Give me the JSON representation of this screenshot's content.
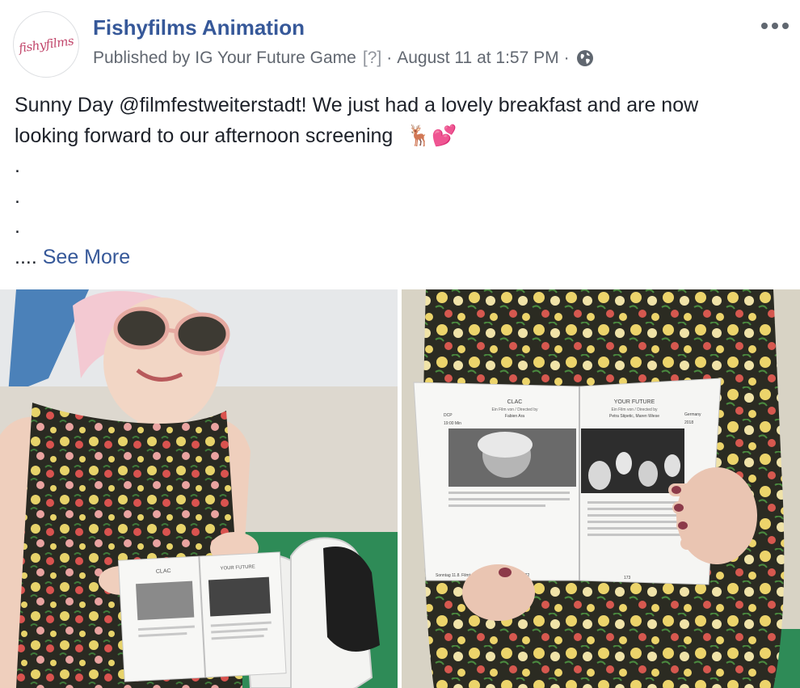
{
  "post": {
    "page_name": "Fishyfilms Animation",
    "avatar_text": "fishyfilms",
    "published_by_prefix": "Published by",
    "publisher": "IG Your Future Game",
    "help_marker": "[?]",
    "separator": "·",
    "timestamp": "August 11 at 1:57 PM",
    "privacy_icon": "globe-icon",
    "more_icon": "more-options-icon"
  },
  "content": {
    "line1": "Sunny Day @filmfestweiterstadt! We just had a lovely breakfast and are now",
    "line2": "looking forward to our afternoon screening",
    "emoji": "🦌💕",
    "dot1": ".",
    "dot2": ".",
    "dot3": ".",
    "ellipsis": "....",
    "see_more": "See More"
  },
  "photos": {
    "left": {
      "booklet_left_title": "CLAC",
      "booklet_right_title": "YOUR FUTURE"
    },
    "right": {
      "booklet_left_title": "CLAC",
      "booklet_left_sub": "Ein Film von / Directed by",
      "booklet_left_director": "Fabien Ara",
      "booklet_left_format": "DCP",
      "booklet_left_time": "19:00 Min",
      "booklet_right_title": "YOUR FUTURE",
      "booklet_right_sub": "Ein Film von / Directed by",
      "booklet_right_director": "Petra Stipetic, Maren Wiese",
      "booklet_right_country": "Germany",
      "booklet_right_year": "2018",
      "booklet_footer_left": "Sonntag 11.8. Filmt",
      "booklet_page_left": "172",
      "booklet_page_right": "173"
    }
  }
}
